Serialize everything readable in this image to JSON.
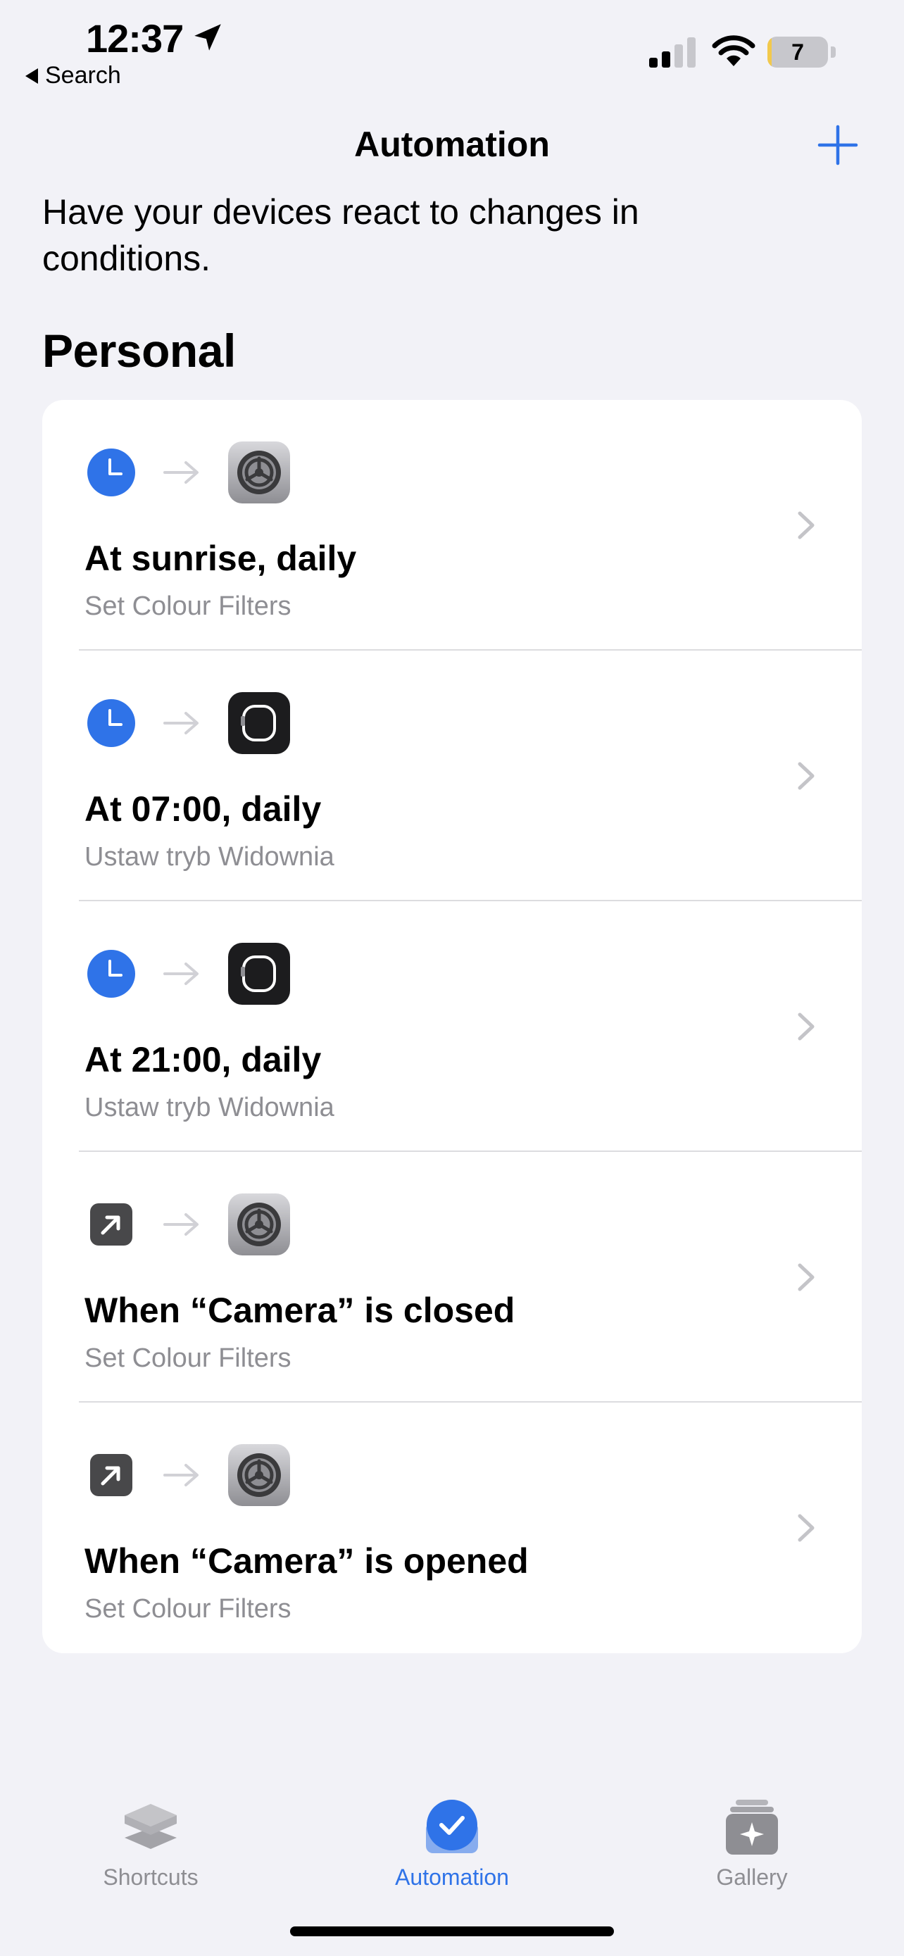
{
  "status": {
    "time": "12:37",
    "back_label": "Search",
    "battery_level": "7",
    "battery_fraction": 0.07
  },
  "nav": {
    "title": "Automation"
  },
  "intro": "Have your devices react to changes in conditions.",
  "section": "Personal",
  "automations": [
    {
      "title": "At sunrise, daily",
      "subtitle": "Set Colour Filters",
      "trigger_icon": "clock-icon",
      "action_icon": "settings-icon"
    },
    {
      "title": "At 07:00, daily",
      "subtitle": "Ustaw tryb Widownia",
      "trigger_icon": "clock-icon",
      "action_icon": "watch-icon"
    },
    {
      "title": "At 21:00, daily",
      "subtitle": "Ustaw tryb Widownia",
      "trigger_icon": "clock-icon",
      "action_icon": "watch-icon"
    },
    {
      "title": "When “Camera” is closed",
      "subtitle": "Set Colour Filters",
      "trigger_icon": "app-open-icon",
      "action_icon": "settings-icon"
    },
    {
      "title": "When “Camera” is opened",
      "subtitle": "Set Colour Filters",
      "trigger_icon": "app-open-icon",
      "action_icon": "settings-icon"
    }
  ],
  "tabs": [
    {
      "label": "Shortcuts",
      "icon": "shortcuts-icon",
      "active": false
    },
    {
      "label": "Automation",
      "icon": "automation-check-icon",
      "active": true
    },
    {
      "label": "Gallery",
      "icon": "gallery-icon",
      "active": false
    }
  ],
  "colors": {
    "accent": "#2f73e8",
    "background": "#f2f2f7",
    "secondary_text": "#8e8e93"
  }
}
